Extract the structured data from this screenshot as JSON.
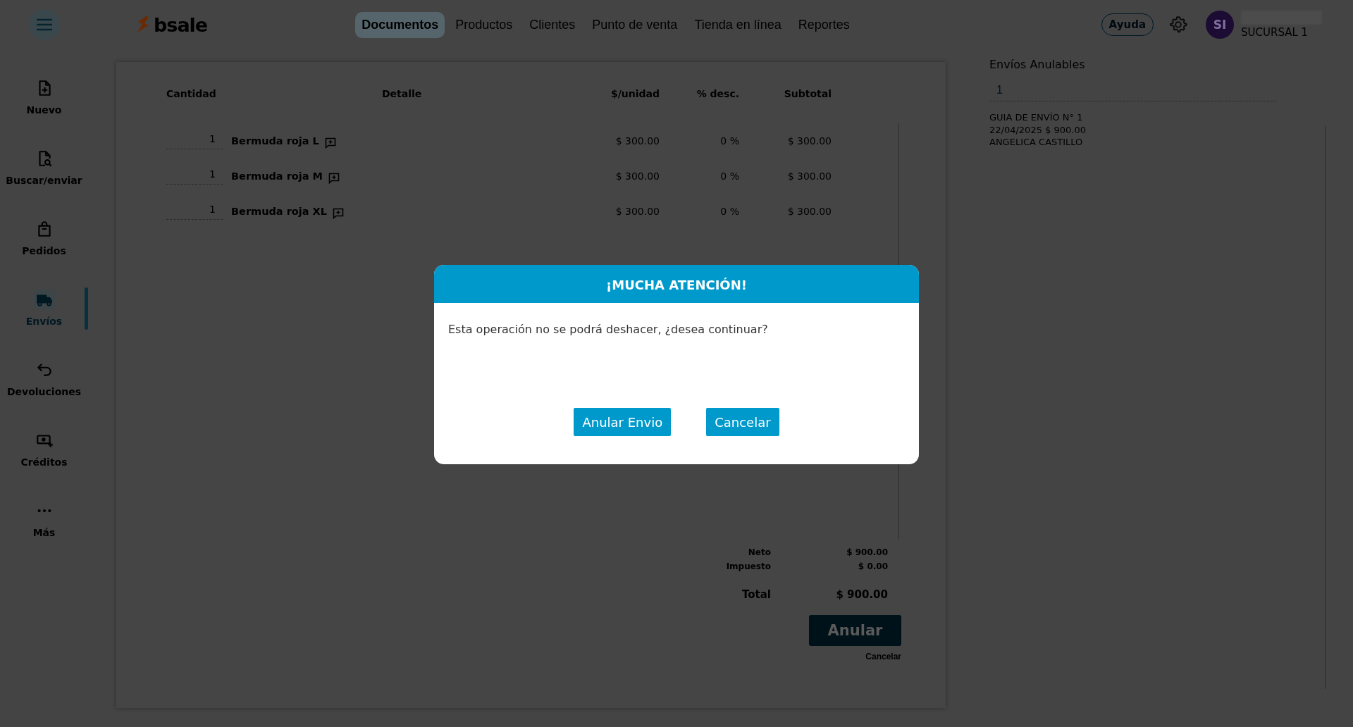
{
  "header": {
    "logo": "bsale",
    "nav": [
      {
        "label": "Documentos",
        "selected": true
      },
      {
        "label": "Productos",
        "selected": false
      },
      {
        "label": "Clientes",
        "selected": false
      },
      {
        "label": "Punto de venta",
        "selected": false
      },
      {
        "label": "Tienda en línea",
        "selected": false
      },
      {
        "label": "Reportes",
        "selected": false
      }
    ],
    "help": "Ayuda",
    "avatar": "SI",
    "branch": "SUCURSAL 1"
  },
  "sidebar": {
    "items": [
      {
        "label": "Nuevo",
        "selected": false
      },
      {
        "label": "Buscar/enviar",
        "selected": false
      },
      {
        "label": "Pedidos",
        "selected": false
      },
      {
        "label": "Envíos",
        "selected": true
      },
      {
        "label": "Devoluciones",
        "selected": false
      },
      {
        "label": "Créditos",
        "selected": false
      },
      {
        "label": "Más",
        "selected": false
      }
    ]
  },
  "document": {
    "columns": [
      "Cantidad",
      "Detalle",
      "$/unidad",
      "% desc.",
      "Subtotal"
    ],
    "rows": [
      {
        "quantity": "1",
        "detail": "Bermuda roja L",
        "unit_price": "$ 300.00",
        "discount": "0 %",
        "subtotal": "$ 300.00"
      },
      {
        "quantity": "1",
        "detail": "Bermuda roja M",
        "unit_price": "$ 300.00",
        "discount": "0 %",
        "subtotal": "$ 300.00"
      },
      {
        "quantity": "1",
        "detail": "Bermuda roja XL",
        "unit_price": "$ 300.00",
        "discount": "0 %",
        "subtotal": "$ 300.00"
      }
    ],
    "totals": [
      {
        "label": "Neto",
        "value": "$ 900.00",
        "kind": "minor"
      },
      {
        "label": "Impuesto",
        "value": "$ 0.00",
        "kind": "minor"
      },
      {
        "label": "Total",
        "value": "$ 900.00",
        "kind": "total"
      }
    ],
    "primary_button": "Anular",
    "cancel_link": "Cancelar"
  },
  "side_panel": {
    "title": "Envíos Anulables",
    "search_value": "1",
    "results": [
      {
        "lines": [
          "GUIA DE ENVÍO N° 1",
          "22/04/2025 $ 900.00",
          "ANGELICA CASTILLO"
        ]
      }
    ]
  },
  "dialog": {
    "title": "¡MUCHA ATENCIÓN!",
    "message": "Esta operación no se podrá deshacer, ¿desea continuar?",
    "buttons": [
      "Anular Envio",
      "Cancelar"
    ]
  }
}
